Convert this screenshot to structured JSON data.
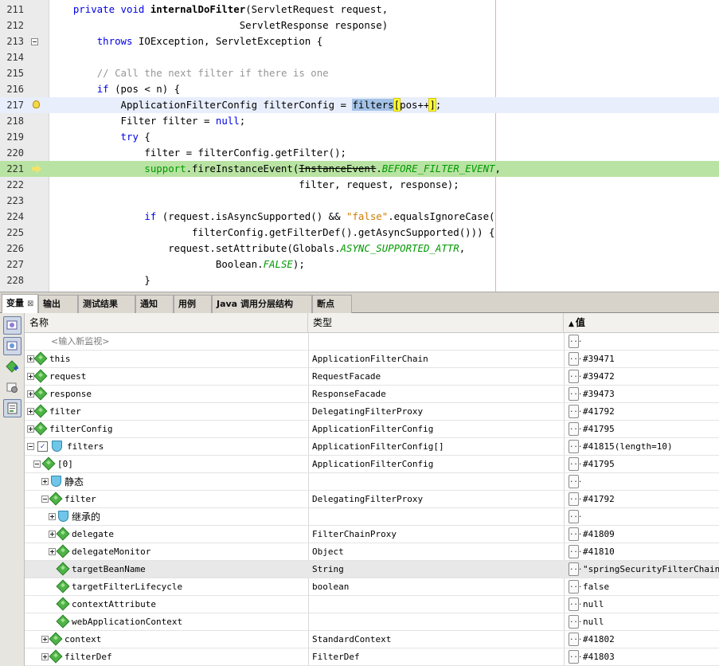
{
  "editor": {
    "lines": [
      {
        "num": "211",
        "parts": [
          {
            "t": "    "
          },
          {
            "t": "private void ",
            "c": "kw"
          },
          {
            "t": "internalDoFilter",
            "c": "b"
          },
          {
            "t": "(ServletRequest request,"
          }
        ]
      },
      {
        "num": "212",
        "parts": [
          {
            "t": "                                ServletResponse response)"
          }
        ]
      },
      {
        "num": "213",
        "parts": [
          {
            "t": "        "
          },
          {
            "t": "throws",
            "c": "kw"
          },
          {
            "t": " IOException, ServletException {"
          }
        ]
      },
      {
        "num": "214",
        "parts": [
          {
            "t": ""
          }
        ]
      },
      {
        "num": "215",
        "parts": [
          {
            "t": "        "
          },
          {
            "t": "// Call the next filter if there is one",
            "c": "cm"
          }
        ]
      },
      {
        "num": "216",
        "parts": [
          {
            "t": "        "
          },
          {
            "t": "if",
            "c": "kw"
          },
          {
            "t": " (pos < n) {"
          }
        ]
      },
      {
        "num": "217",
        "parts": [
          {
            "t": "            ApplicationFilterConfig filterConfig = "
          },
          {
            "t": "filters",
            "c": "sel"
          },
          {
            "t": "[",
            "c": "brk"
          },
          {
            "t": "pos++"
          },
          {
            "t": "]",
            "c": "brk"
          },
          {
            "t": ";"
          }
        ]
      },
      {
        "num": "218",
        "parts": [
          {
            "t": "            Filter filter = "
          },
          {
            "t": "null",
            "c": "kw"
          },
          {
            "t": ";"
          }
        ]
      },
      {
        "num": "219",
        "parts": [
          {
            "t": "            "
          },
          {
            "t": "try",
            "c": "kw"
          },
          {
            "t": " {"
          }
        ]
      },
      {
        "num": "220",
        "parts": [
          {
            "t": "                filter = filterConfig.getFilter();"
          }
        ]
      },
      {
        "num": "221",
        "parts": [
          {
            "t": "                "
          },
          {
            "t": "support",
            "c": "fld2"
          },
          {
            "t": ".fireInstanceEvent("
          },
          {
            "t": "InstanceEvent",
            "c": "strike"
          },
          {
            "t": "."
          },
          {
            "t": "BEFORE_FILTER_EVENT",
            "c": "fld"
          },
          {
            "t": ","
          }
        ]
      },
      {
        "num": "222",
        "parts": [
          {
            "t": "                                          filter, request, response);"
          }
        ]
      },
      {
        "num": "223",
        "parts": [
          {
            "t": ""
          }
        ]
      },
      {
        "num": "224",
        "parts": [
          {
            "t": "                "
          },
          {
            "t": "if",
            "c": "kw"
          },
          {
            "t": " (request.isAsyncSupported() && "
          },
          {
            "t": "\"false\"",
            "c": "st"
          },
          {
            "t": ".equalsIgnoreCase("
          }
        ]
      },
      {
        "num": "225",
        "parts": [
          {
            "t": "                        filterConfig.getFilterDef().getAsyncSupported())) {"
          }
        ]
      },
      {
        "num": "226",
        "parts": [
          {
            "t": "                    request.setAttribute(Globals."
          },
          {
            "t": "ASYNC_SUPPORTED_ATTR",
            "c": "fld"
          },
          {
            "t": ","
          }
        ]
      },
      {
        "num": "227",
        "parts": [
          {
            "t": "                            Boolean."
          },
          {
            "t": "FALSE",
            "c": "fld"
          },
          {
            "t": ");"
          }
        ]
      },
      {
        "num": "228",
        "parts": [
          {
            "t": "                }"
          }
        ]
      }
    ]
  },
  "tabs": [
    {
      "label": "变量",
      "close": "⊠"
    },
    {
      "label": "输出"
    },
    {
      "label": "测试结果"
    },
    {
      "label": "通知"
    },
    {
      "label": "用例"
    },
    {
      "label": "Java 调用分层结构"
    },
    {
      "label": "断点"
    }
  ],
  "table": {
    "headers": {
      "name": "名称",
      "type": "类型",
      "value": "值",
      "sort_indicator": "▲"
    },
    "watch_placeholder": "<输入新监视>",
    "rows": [
      {
        "name": "this",
        "type": "ApplicationFilterChain",
        "value": "#39471"
      },
      {
        "name": "request",
        "type": "RequestFacade",
        "value": "#39472"
      },
      {
        "name": "response",
        "type": "ResponseFacade",
        "value": "#39473"
      },
      {
        "name": "filter",
        "type": "DelegatingFilterProxy",
        "value": "#41792"
      },
      {
        "name": "filterConfig",
        "type": "ApplicationFilterConfig",
        "value": "#41795"
      },
      {
        "name": "filters",
        "type": "ApplicationFilterConfig[]",
        "value": "#41815(length=10)"
      },
      {
        "name": "[0]",
        "type": "ApplicationFilterConfig",
        "value": "#41795"
      },
      {
        "name": "静态",
        "type": "",
        "value": ""
      },
      {
        "name": "filter",
        "type": "DelegatingFilterProxy",
        "value": "#41792"
      },
      {
        "name": "继承的",
        "type": "",
        "value": ""
      },
      {
        "name": "delegate",
        "type": "FilterChainProxy",
        "value": "#41809"
      },
      {
        "name": "delegateMonitor",
        "type": "Object",
        "value": "#41810"
      },
      {
        "name": "targetBeanName",
        "type": "String",
        "value": "\"springSecurityFilterChain\""
      },
      {
        "name": "targetFilterLifecycle",
        "type": "boolean",
        "value": "false"
      },
      {
        "name": "contextAttribute",
        "type": "",
        "value": "null"
      },
      {
        "name": "webApplicationContext",
        "type": "",
        "value": "null"
      },
      {
        "name": "context",
        "type": "StandardContext",
        "value": "#41802"
      },
      {
        "name": "filterDef",
        "type": "FilterDef",
        "value": "#41803"
      }
    ],
    "dots_label": "..."
  },
  "colors": {
    "debug_line": "#b8e3a2",
    "current_line": "#e8eefc",
    "keyword": "#0000e6",
    "field": "#009900"
  }
}
